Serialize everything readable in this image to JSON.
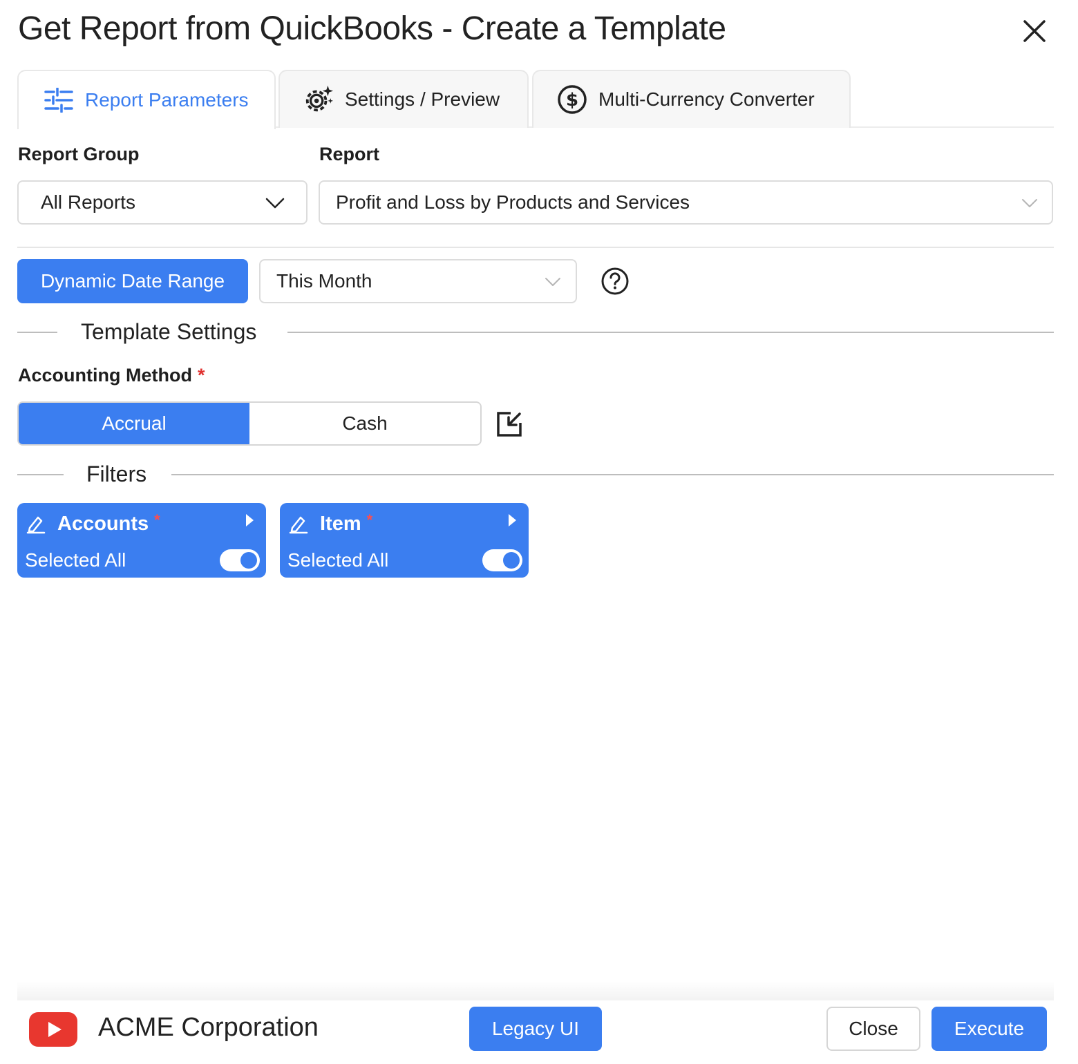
{
  "dialog": {
    "title": "Get Report from QuickBooks - Create a Template"
  },
  "tabs": [
    {
      "label": "Report Parameters",
      "icon": "sliders-icon",
      "active": true
    },
    {
      "label": "Settings / Preview",
      "icon": "gear-sparkle-icon",
      "active": false
    },
    {
      "label": "Multi-Currency Converter",
      "icon": "dollar-circle-icon",
      "active": false
    }
  ],
  "report_group": {
    "label": "Report Group",
    "value": "All Reports"
  },
  "report": {
    "label": "Report",
    "value": "Profit and Loss by Products and Services"
  },
  "date_range": {
    "button_label": "Dynamic Date Range",
    "value": "This Month"
  },
  "template_settings": {
    "title": "Template Settings"
  },
  "accounting_method": {
    "label": "Accounting Method",
    "required_mark": "*",
    "options": [
      "Accrual",
      "Cash"
    ],
    "selected": "Accrual"
  },
  "filters": {
    "title": "Filters",
    "items": [
      {
        "name": "Accounts",
        "required_mark": "*",
        "value": "Selected All",
        "toggle_on": true
      },
      {
        "name": "Item",
        "required_mark": "*",
        "value": "Selected All",
        "toggle_on": true
      }
    ]
  },
  "footer": {
    "company": "ACME Corporation",
    "legacy_label": "Legacy UI",
    "close_label": "Close",
    "execute_label": "Execute"
  },
  "colors": {
    "accent": "#3b7ef0",
    "required": "#e0312f",
    "logo_red": "#e8372f"
  }
}
